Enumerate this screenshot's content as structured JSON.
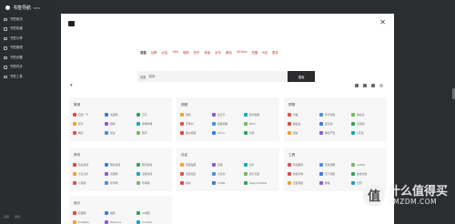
{
  "app": {
    "name": "书签导航",
    "badge": "NEW"
  },
  "sidebar": {
    "items": [
      {
        "label": "书签首页"
      },
      {
        "label": "书签收藏"
      },
      {
        "label": "书签分享"
      },
      {
        "label": "书签管理"
      },
      {
        "label": "书签设置"
      },
      {
        "label": "书签同步"
      },
      {
        "label": "书签工具"
      }
    ],
    "footer": [
      "设置",
      "退出"
    ]
  },
  "modal": {
    "close_icon": "close-icon",
    "engines": [
      "百度",
      "谷歌",
      "必应",
      "360",
      "搜狗",
      "知乎",
      "淘宝",
      "京东",
      "微信",
      "GitHub",
      "豆瓣",
      "B站",
      "更多"
    ],
    "active_engine": 0,
    "search": {
      "label": "百度",
      "placeholder": "搜索",
      "button": "搜索"
    }
  },
  "sections": [
    {
      "title": "常用",
      "links": [
        "百度一下",
        "淘宝网",
        "京东",
        "知乎",
        "微博",
        "哔哩哔哩",
        "网易",
        "新浪",
        "腾讯"
      ]
    },
    {
      "title": "视频",
      "links": [
        "优酷",
        "爱奇艺",
        "腾讯视频",
        "芒果TV",
        "搜狐视频",
        "PPTV",
        "西瓜视频",
        "AcFun",
        "抖音"
      ]
    },
    {
      "title": "购物",
      "links": [
        "天猫",
        "苏宁易购",
        "拼多多",
        "唯品会",
        "亚马逊",
        "当当网",
        "闲鱼",
        "网易严选",
        "1号店"
      ]
    },
    {
      "title": "资讯",
      "links": [
        "新浪新闻",
        "网易新闻",
        "腾讯新闻",
        "今日头条",
        "凤凰网",
        "澎湃新闻",
        "人民网",
        "新华网",
        "环球网"
      ]
    },
    {
      "title": "社区",
      "links": [
        "百度贴吧",
        "豆瓣",
        "虎扑",
        "天涯社区",
        "小红书",
        "知乎日报",
        "简书",
        "CSDN",
        "SegmentFault"
      ]
    },
    {
      "title": "工具",
      "links": [
        "有道翻译",
        "百度地图",
        "12306",
        "快递查询",
        "天气预报",
        "在线文档",
        "百度网盘",
        "邮箱",
        "日历"
      ]
    },
    {
      "title": "设计",
      "links": [
        "花瓣网",
        "站酷",
        "UI中国",
        "Dribbble",
        "Behance",
        "iconfont"
      ]
    }
  ],
  "colors": {
    "link_icons": [
      "#e04a3f",
      "#3b7be0",
      "#2fa35a",
      "#f0a22e",
      "#8a5cd1",
      "#1aa6b7",
      "#d9534f",
      "#4a90d9",
      "#7bb661"
    ]
  },
  "watermark": {
    "badge": "值",
    "line1": "什么值得买",
    "line2": "SMZDM.COM"
  }
}
